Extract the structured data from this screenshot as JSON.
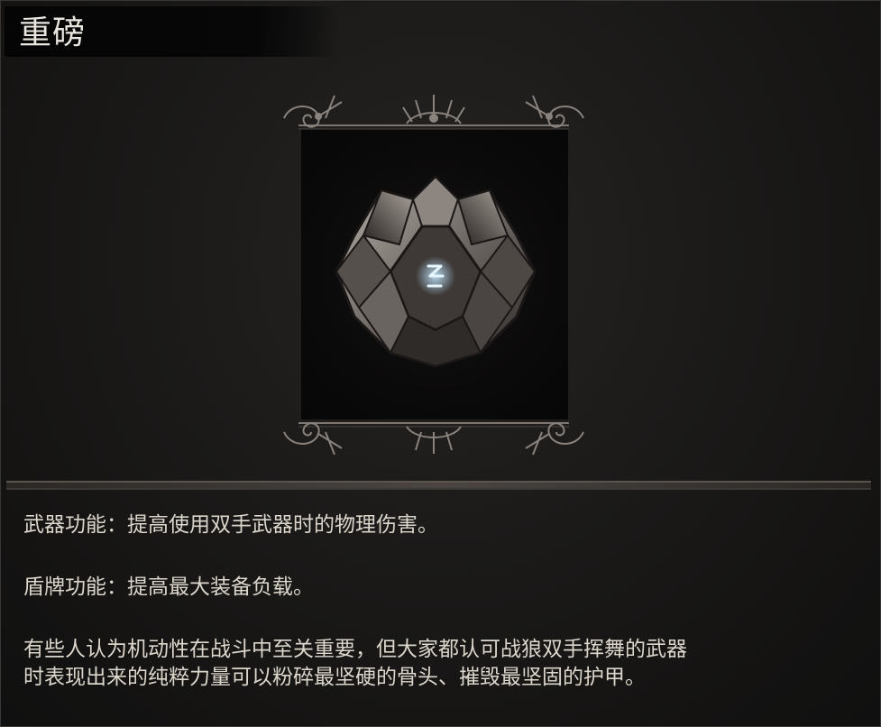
{
  "item": {
    "title": "重磅",
    "icon": "heavy-shield-rune-icon",
    "rune_symbol": "⟠"
  },
  "description": {
    "weapon_function": "武器功能：提高使用双手武器时的物理伤害。",
    "shield_function": "盾牌功能：提高最大装备负载。",
    "lore_line1": "有些人认为机动性在战斗中至关重要，但大家都认可战狼双手挥舞的武器",
    "lore_line2": "时表现出来的纯粹力量可以粉碎最坚硬的骨头、摧毁最坚固的护甲。"
  },
  "colors": {
    "background": "#1b1a19",
    "text": "#dcd6cc",
    "rune_glow": "#9fd4ff"
  }
}
